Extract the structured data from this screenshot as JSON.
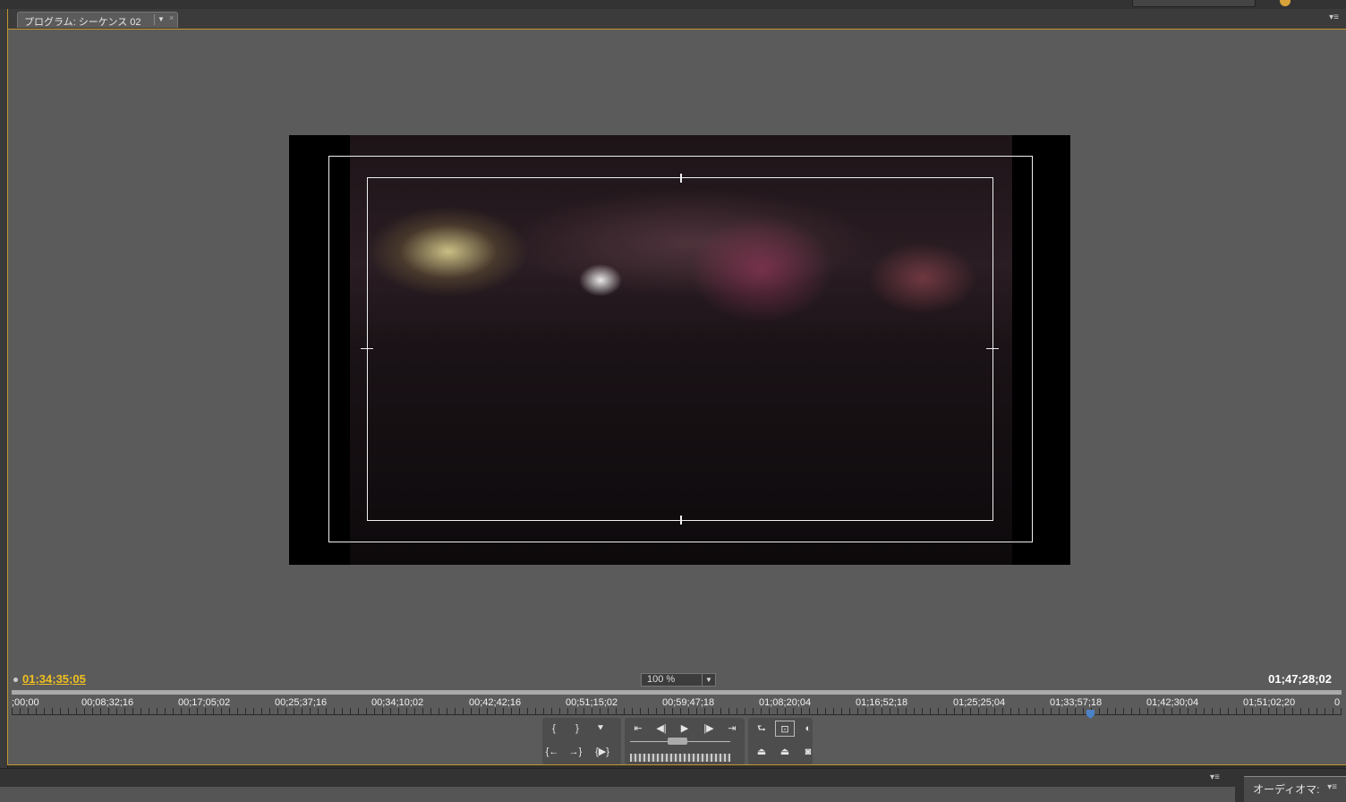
{
  "panel": {
    "tab_title": "プログラム: シーケンス 02",
    "tab_dropdown_glyph": "▼",
    "tab_close_glyph": "×",
    "menu_glyph": "▾≡"
  },
  "monitor": {
    "current_timecode": "01;34;35;05",
    "duration_timecode": "01;47;28;02",
    "zoom": "100 %",
    "zoom_arrow": "▼"
  },
  "ruler": {
    "labels": [
      ";00;00",
      "00;08;32;16",
      "00;17;05;02",
      "00;25;37;16",
      "00;34;10;02",
      "00;42;42;16",
      "00;51;15;02",
      "00;59;47;18",
      "01;08;20;04",
      "01;16;52;18",
      "01;25;25;04",
      "01;33;57;18",
      "01;42;30;04",
      "01;51;02;20",
      "0"
    ]
  },
  "controls": {
    "mark_in": "{",
    "mark_out": "}",
    "set_marker": "⯆",
    "go_to_in": "⇤",
    "step_back": "◀|",
    "play": "▶",
    "step_forward": "|▶",
    "go_to_out": "⇥",
    "loop": "⮑",
    "safe_margins": "⊡",
    "output": "◐",
    "shuttle_left": "{←",
    "shuttle_right": "→}",
    "play_in_to_out": "{▶}",
    "lift": "⏏",
    "extract": "⏏",
    "export_frame": "◙"
  },
  "bottom": {
    "audio_tab": "オーディオマ:",
    "menu_glyph": "▾≡"
  },
  "colors": {
    "accent": "#c2962d",
    "timecode_current": "#f0c020",
    "playhead": "#4b82c8"
  }
}
